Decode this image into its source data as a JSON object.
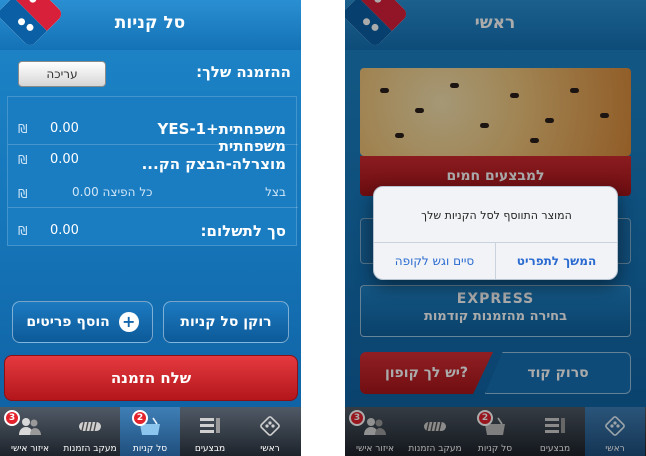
{
  "left_screen": {
    "title": "סל קניות",
    "order_label": "ההזמנה שלך:",
    "edit_button": "עריכה",
    "currency": "₪",
    "items": [
      {
        "name": "משפחתית+YES-1",
        "price": "0.00"
      },
      {
        "name_line1": "משפחתית",
        "name_line2": "מוצרלה-הבצק הק...",
        "price": "0.00"
      }
    ],
    "sub_item": {
      "label": "בצל",
      "price_text": "כל הפיצה 0.00"
    },
    "total_label": "סך לתשלום:",
    "total_value": "0.00",
    "add_items_button": "הוסף פריטים",
    "empty_cart_button": "רוקן סל קניות",
    "send_order_button": "שלח הזמנה"
  },
  "right_screen": {
    "title": "ראשי",
    "hot_deals_label": "למבצעים חמים",
    "express_label": "EXPRESS",
    "previous_orders_label": "בחירה מהזמנות קודמות",
    "coupon_label": "יש לך קופון?",
    "scan_code_label": "סרוק קוד",
    "dialog": {
      "message": "המוצר התווסף לסל הקניות שלך",
      "continue_button": "המשך לתפריט",
      "checkout_button": "סיים וגש לקופה"
    }
  },
  "tabbar": {
    "tabs": [
      {
        "label": "ראשי",
        "icon": "domino-logo-icon"
      },
      {
        "label": "מבצעים",
        "icon": "list-icon"
      },
      {
        "label": "סל קניות",
        "icon": "shopping-basket-icon"
      },
      {
        "label": "מעקב הזמנות",
        "icon": "tracker-icon"
      },
      {
        "label": "איזור אישי",
        "icon": "users-icon"
      }
    ],
    "cart_badge": "2",
    "personal_badge": "3"
  },
  "colors": {
    "brand_blue": "#1677bb",
    "brand_red": "#d72f35",
    "tab_active": "#3f7fb6"
  }
}
